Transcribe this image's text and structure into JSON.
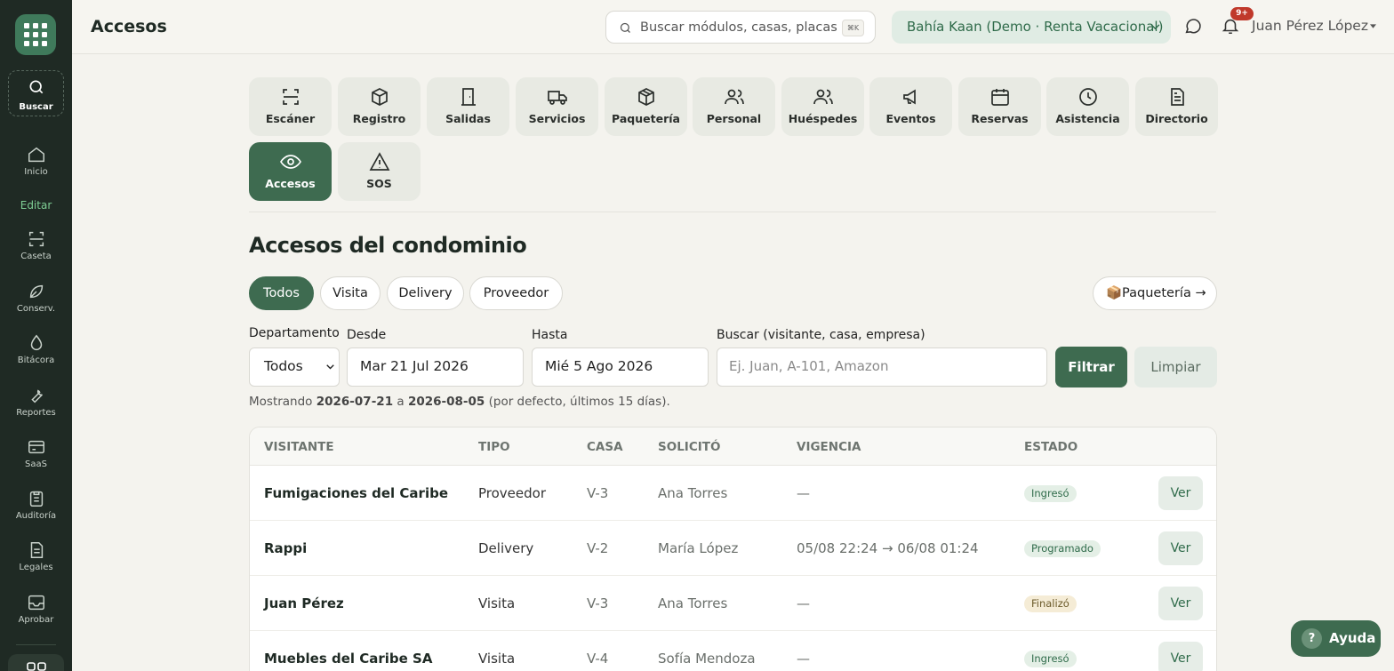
{
  "rail": {
    "search_label": "Buscar",
    "items": [
      {
        "label": "Inicio",
        "icon": "home-icon"
      },
      {
        "label": "Caseta",
        "icon": "scan-icon"
      },
      {
        "label": "Conserv.",
        "icon": "leaf-icon"
      },
      {
        "label": "Bitácora",
        "icon": "drop-icon"
      },
      {
        "label": "Reportes",
        "icon": "wrench-icon"
      },
      {
        "label": "SaaS",
        "icon": "card-icon"
      },
      {
        "label": "Auditoría",
        "icon": "clipboard-icon"
      },
      {
        "label": "Legales",
        "icon": "document-icon"
      },
      {
        "label": "Aprobar",
        "icon": "inbox-icon"
      }
    ],
    "edit_label": "Editar"
  },
  "header": {
    "title": "Accesos",
    "search_placeholder": "Buscar módulos, casas, placas…",
    "search_shortcut": "⌘K",
    "tenant": "Bahía Kaan (Demo · Renta Vacacional)",
    "notifications": "9+",
    "user": "Juan Pérez López"
  },
  "modules": [
    {
      "label": "Escáner",
      "icon": "scan-icon"
    },
    {
      "label": "Registro",
      "icon": "box-icon"
    },
    {
      "label": "Salidas",
      "icon": "exit-door-icon"
    },
    {
      "label": "Servicios",
      "icon": "truck-icon"
    },
    {
      "label": "Paquetería",
      "icon": "package-icon"
    },
    {
      "label": "Personal",
      "icon": "users-icon"
    },
    {
      "label": "Huéspedes",
      "icon": "guests-icon"
    },
    {
      "label": "Eventos",
      "icon": "megaphone-icon"
    },
    {
      "label": "Reservas",
      "icon": "calendar-icon"
    },
    {
      "label": "Asistencia",
      "icon": "clock-icon"
    },
    {
      "label": "Directorio",
      "icon": "file-icon"
    },
    {
      "label": "Accesos",
      "icon": "eye-icon",
      "active": true
    },
    {
      "label": "SOS",
      "icon": "warning-icon"
    }
  ],
  "section": {
    "title": "Accesos del condominio",
    "filters": [
      "Todos",
      "Visita",
      "Delivery",
      "Proveedor"
    ],
    "active_filter": "Todos",
    "paqueteria_link": "📦Paquetería →"
  },
  "form": {
    "department_label": "Departamento",
    "department_value": "Todos",
    "from_label": "Desde",
    "from_value": "Mar 21 Jul 2026",
    "to_label": "Hasta",
    "to_value": "Mié 5 Ago 2026",
    "search_label": "Buscar (visitante, casa, empresa)",
    "search_placeholder": "Ej. Juan, A-101, Amazon",
    "search_value": "",
    "filter_button": "Filtrar",
    "clear_button": "Limpiar",
    "hint_prefix": "Mostrando ",
    "hint_from": "2026-07-21",
    "hint_mid": " a ",
    "hint_to": "2026-08-05",
    "hint_suffix": " (por defecto, últimos 15 días)."
  },
  "table": {
    "columns": [
      "VISITANTE",
      "TIPO",
      "CASA",
      "SOLICITÓ",
      "VIGENCIA",
      "ESTADO"
    ],
    "rows": [
      {
        "visitor": "Fumigaciones del Caribe",
        "type": "Proveedor",
        "house": "V-3",
        "requested_by": "Ana Torres",
        "validity": "—",
        "status": "Ingresó",
        "status_kind": "in",
        "action": "Ver"
      },
      {
        "visitor": "Rappi",
        "type": "Delivery",
        "house": "V-2",
        "requested_by": "María López",
        "validity": "05/08 22:24 → 06/08 01:24",
        "status": "Programado",
        "status_kind": "sched",
        "action": "Ver"
      },
      {
        "visitor": "Juan Pérez",
        "type": "Visita",
        "house": "V-3",
        "requested_by": "Ana Torres",
        "validity": "—",
        "status": "Finalizó",
        "status_kind": "done",
        "action": "Ver"
      },
      {
        "visitor": "Muebles del Caribe SA",
        "type": "Visita",
        "house": "V-4",
        "requested_by": "Sofía Mendoza",
        "validity": "—",
        "status": "Ingresó",
        "status_kind": "in",
        "action": "Ver"
      }
    ]
  },
  "help_label": "Ayuda",
  "colors": {
    "primary": "#3e6b50",
    "rail": "#1f2a24",
    "accent_green": "#7fcf95",
    "badge_red": "#c0392b"
  }
}
